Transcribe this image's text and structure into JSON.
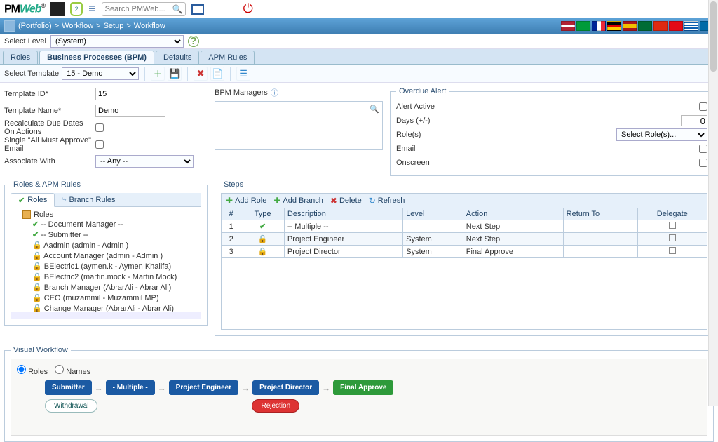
{
  "app": {
    "name": "PMWeb",
    "search_placeholder": "Search PMWeb...",
    "shield_badge": "2"
  },
  "breadcrumb": {
    "portfolio": "(Portfolio)",
    "p1": "Workflow",
    "p2": "Setup",
    "p3": "Workflow"
  },
  "select_level": {
    "label": "Select Level",
    "value": "(System)"
  },
  "tabs": [
    "Roles",
    "Business Processes (BPM)",
    "Defaults",
    "APM Rules"
  ],
  "template_bar": {
    "label": "Select Template",
    "value": "15 - Demo"
  },
  "form": {
    "template_id_label": "Template ID*",
    "template_id": "15",
    "template_name_label": "Template Name*",
    "template_name": "Demo",
    "recalc_label": "Recalculate Due Dates On Actions",
    "single_email_label": "Single \"All Must Approve\" Email",
    "associate_label": "Associate With",
    "associate_value": "-- Any --"
  },
  "bpm_managers": {
    "title": "BPM Managers"
  },
  "overdue": {
    "title": "Overdue Alert",
    "active_label": "Alert Active",
    "days_label": "Days (+/-)",
    "days_value": "0",
    "roles_label": "Role(s)",
    "roles_placeholder": "Select Role(s)...",
    "email_label": "Email",
    "onscreen_label": "Onscreen"
  },
  "roles_panel": {
    "title": "Roles & APM Rules",
    "tabs": [
      "Roles",
      "Branch Rules"
    ],
    "root": "Roles",
    "items": [
      {
        "icon": "check",
        "text": "-- Document Manager --"
      },
      {
        "icon": "check",
        "text": "-- Submitter --"
      },
      {
        "icon": "lock",
        "text": "Aadmin (admin - Admin )"
      },
      {
        "icon": "lock",
        "text": "Account Manager (admin - Admin )"
      },
      {
        "icon": "lock",
        "text": "BElectric1 (aymen.k - Aymen Khalifa)"
      },
      {
        "icon": "lock",
        "text": "BElectric2 (martin.mock - Martin Mock)"
      },
      {
        "icon": "lock",
        "text": "Branch Manager (AbrarAli - Abrar Ali)"
      },
      {
        "icon": "lock",
        "text": "CEO (muzammil - Muzammil MP)"
      },
      {
        "icon": "lock",
        "text": "Change Manager (AbrarAli - Abrar Ali)"
      }
    ]
  },
  "steps_panel": {
    "title": "Steps",
    "toolbar": [
      "Add Role",
      "Add Branch",
      "Delete",
      "Refresh"
    ],
    "headers": [
      "#",
      "Type",
      "Description",
      "Level",
      "Action",
      "Return To",
      "Delegate"
    ],
    "rows": [
      {
        "n": "1",
        "type": "check",
        "desc": "-- Multiple --",
        "level": "",
        "action": "Next Step",
        "ret": ""
      },
      {
        "n": "2",
        "type": "lock",
        "desc": "Project Engineer",
        "level": "System",
        "action": "Next Step",
        "ret": ""
      },
      {
        "n": "3",
        "type": "lock",
        "desc": "Project Director",
        "level": "System",
        "action": "Final Approve",
        "ret": ""
      }
    ]
  },
  "visual_workflow": {
    "title": "Visual Workflow",
    "radio_roles": "Roles",
    "radio_names": "Names",
    "nodes": [
      "Submitter",
      "- Multiple -",
      "Project Engineer",
      "Project Director"
    ],
    "final": "Final Approve",
    "withdrawal": "Withdrawal",
    "rejection": "Rejection"
  },
  "flags": [
    {
      "name": "us",
      "c": "linear-gradient(#b22234 33%,#fff 33%,#fff 66%,#b22234 66%)"
    },
    {
      "name": "br",
      "c": "#009b3a"
    },
    {
      "name": "fr",
      "c": "linear-gradient(90deg,#002395 33%,#fff 33%,#fff 66%,#ed2939 66%)"
    },
    {
      "name": "de",
      "c": "linear-gradient(#000 33%,#d00 33%,#d00 66%,#fc0 66%)"
    },
    {
      "name": "es",
      "c": "linear-gradient(#aa151b 25%,#f1bf00 25%,#f1bf00 75%,#aa151b 75%)"
    },
    {
      "name": "sa",
      "c": "#006c35"
    },
    {
      "name": "cn",
      "c": "#de2910"
    },
    {
      "name": "tr",
      "c": "#e30a17"
    },
    {
      "name": "gr",
      "c": "repeating-linear-gradient(#0d5eaf 0 2px,#fff 2px 4px)"
    },
    {
      "name": "se",
      "c": "#006aa7"
    }
  ]
}
